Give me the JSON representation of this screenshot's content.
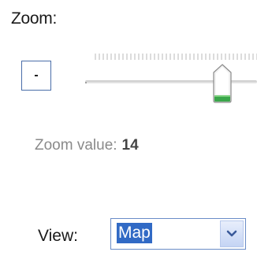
{
  "zoom": {
    "label": "Zoom:",
    "zoom_out_icon": "minus-icon",
    "slider": {
      "level_fraction": 0.8
    },
    "value_label": "Zoom value:",
    "value": "14"
  },
  "view": {
    "label": "View:",
    "selected": "Map",
    "dropdown_icon": "chevron-down-icon"
  },
  "colors": {
    "button_border": "#4a6ea9",
    "selection_bg": "#316ac5",
    "thumb_accent": "#3aa64a",
    "dropdown_arrow": "#3a5a9a"
  }
}
